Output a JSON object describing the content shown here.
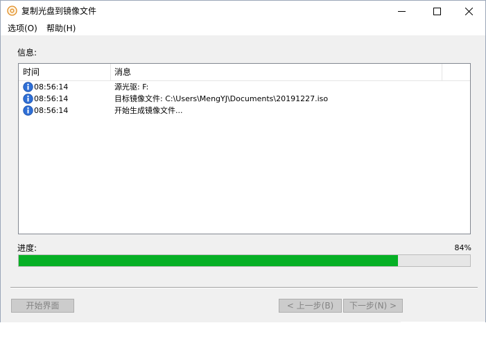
{
  "window": {
    "title": "复制光盘到镜像文件",
    "icon": "disc-icon"
  },
  "menu": {
    "items": [
      "选项(O)",
      "帮助(H)"
    ]
  },
  "info": {
    "label": "信息:",
    "columns": [
      "时间",
      "消息"
    ],
    "rows": [
      {
        "icon": "info-icon",
        "time": "08:56:14",
        "message": "源光驱: F:"
      },
      {
        "icon": "info-icon",
        "time": "08:56:14",
        "message": "目标镜像文件: C:\\Users\\MengYJ\\Documents\\20191227.iso"
      },
      {
        "icon": "info-icon",
        "time": "08:56:14",
        "message": "开始生成镜像文件..."
      }
    ]
  },
  "progress": {
    "label": "进度:",
    "percent_text": "84%",
    "value": 0.84,
    "color": "#06b025"
  },
  "buttons": {
    "home": "开始界面",
    "back": "< 上一步(B)",
    "next": "下一步(N) >"
  }
}
